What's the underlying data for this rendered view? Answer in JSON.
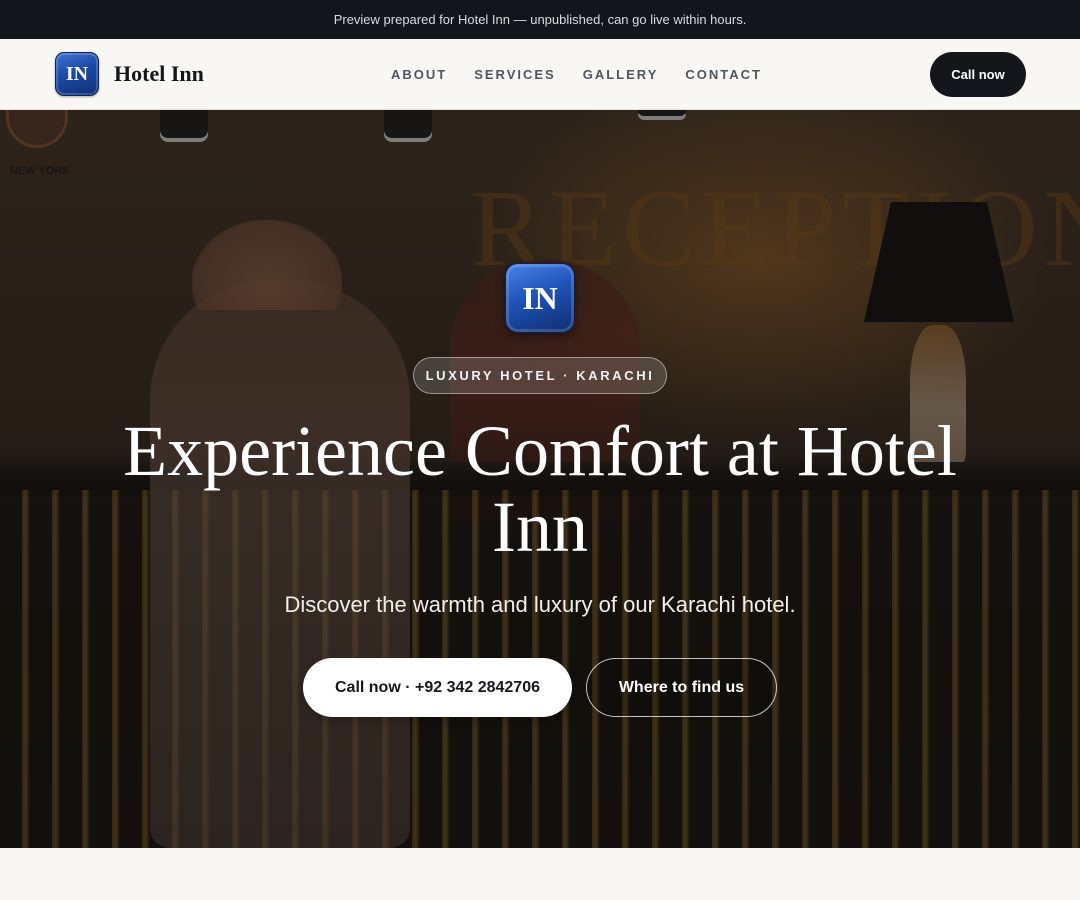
{
  "banner": {
    "text": "Preview prepared for Hotel Inn — unpublished, can go live within hours."
  },
  "nav": {
    "logo_text": "IN",
    "brand": "Hotel Inn",
    "links": [
      "ABOUT",
      "SERVICES",
      "GALLERY",
      "CONTACT"
    ],
    "cta": "Call now"
  },
  "hero": {
    "logo_text": "IN",
    "eyebrow": "LUXURY HOTEL · KARACHI",
    "headline": "Experience Comfort at Hotel Inn",
    "subhead": "Discover the warmth and luxury of our Karachi hotel.",
    "primary_cta": "Call now · +92 342 2842706",
    "secondary_cta": "Where to find us",
    "photo": {
      "wall_sign": "RECEPTION",
      "clock_label": "NEW YORK"
    }
  },
  "colors": {
    "banner_bg": "#12151a",
    "nav_bg": "#f8f7f3",
    "logo_blue": "#1c4aa8",
    "dark_button": "#14161b",
    "white": "#ffffff"
  }
}
